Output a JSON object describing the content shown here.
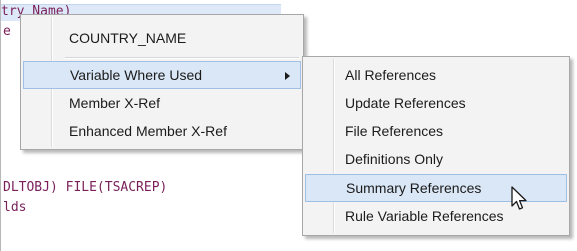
{
  "editor": {
    "lines": [
      "try Name)",
      "e",
      "DLTOBJ) FILE(TSACREP)",
      "lds"
    ]
  },
  "context_menu": {
    "items": [
      {
        "label": "COUNTRY_NAME"
      },
      {
        "label": "Variable Where Used"
      },
      {
        "label": "Member X-Ref"
      },
      {
        "label": "Enhanced Member X-Ref"
      }
    ]
  },
  "submenu": {
    "items": [
      {
        "label": "All References"
      },
      {
        "label": "Update References"
      },
      {
        "label": "File References"
      },
      {
        "label": "Definitions Only"
      },
      {
        "label": "Summary References"
      },
      {
        "label": "Rule Variable References"
      }
    ]
  },
  "colors": {
    "code_text": "#7a1f5a",
    "highlight": "#dae7f6",
    "highlight_border": "#9fbfe4",
    "menu_background": "#f3f3f3"
  },
  "icons": {
    "submenu_arrow": "chevron-right-icon",
    "cursor": "mouse-pointer-icon"
  }
}
